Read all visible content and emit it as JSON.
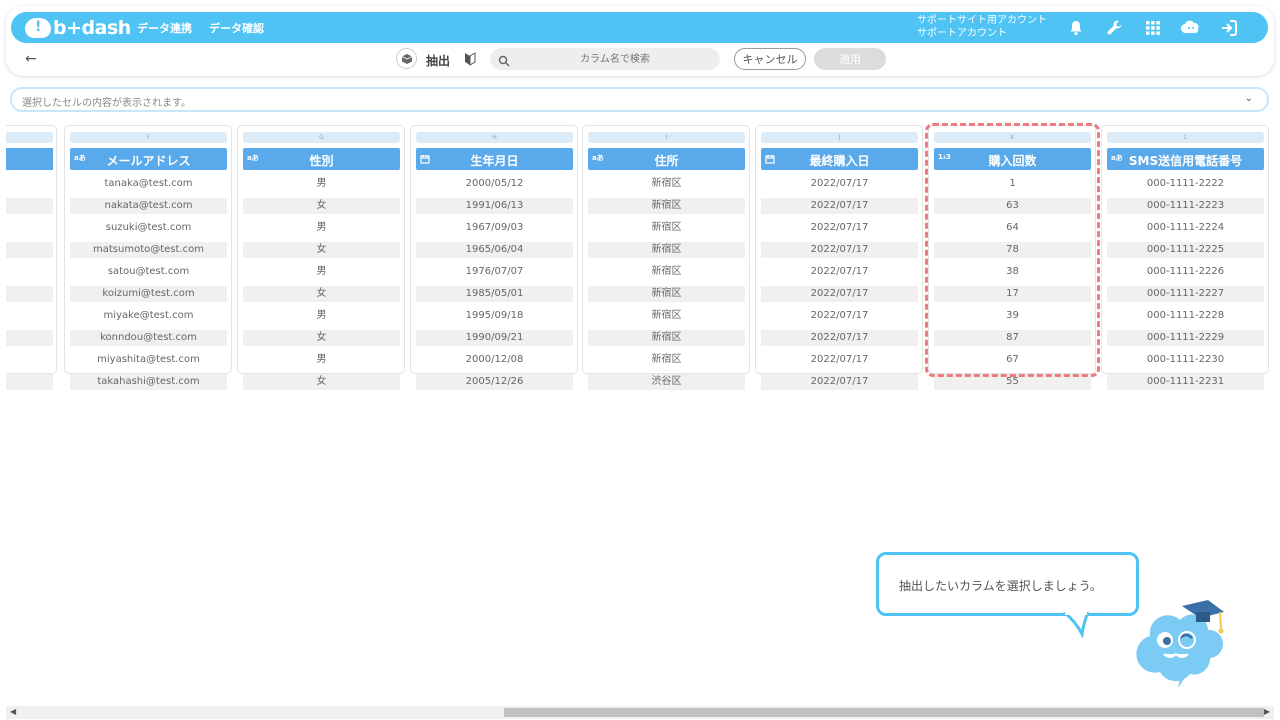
{
  "app": {
    "logo_text": "b+dash"
  },
  "nav": {
    "data_link": "データ連携",
    "data_check": "データ確認"
  },
  "account": {
    "line1": "サポートサイト用アカウント",
    "line2": "サポートアカウント"
  },
  "toolbar": {
    "extract_label": "抽出",
    "search_placeholder": "カラム名で検索",
    "cancel_label": "キャンセル",
    "apply_label": "適用"
  },
  "cell_content": {
    "placeholder": "選択したセルの内容が表示されます。"
  },
  "columns": [
    {
      "letter": "F",
      "type": "aあ",
      "name": "メールアドレス",
      "cells": [
        "tanaka@test.com",
        "nakata@test.com",
        "suzuki@test.com",
        "matsumoto@test.com",
        "satou@test.com",
        "koizumi@test.com",
        "miyake@test.com",
        "konndou@test.com",
        "miyashita@test.com",
        "takahashi@test.com"
      ]
    },
    {
      "letter": "G",
      "type": "aあ",
      "name": "性別",
      "cells": [
        "男",
        "女",
        "男",
        "女",
        "男",
        "女",
        "男",
        "女",
        "男",
        "女"
      ]
    },
    {
      "letter": "H",
      "type": "cal",
      "name": "生年月日",
      "cells": [
        "2000/05/12",
        "1991/06/13",
        "1967/09/03",
        "1965/06/04",
        "1976/07/07",
        "1985/05/01",
        "1995/09/18",
        "1990/09/21",
        "2000/12/08",
        "2005/12/26"
      ]
    },
    {
      "letter": "I",
      "type": "aあ",
      "name": "住所",
      "cells": [
        "新宿区",
        "新宿区",
        "新宿区",
        "新宿区",
        "新宿区",
        "新宿区",
        "新宿区",
        "新宿区",
        "新宿区",
        "渋谷区"
      ]
    },
    {
      "letter": "J",
      "type": "cal",
      "name": "最終購入日",
      "cells": [
        "2022/07/17",
        "2022/07/17",
        "2022/07/17",
        "2022/07/17",
        "2022/07/17",
        "2022/07/17",
        "2022/07/17",
        "2022/07/17",
        "2022/07/17",
        "2022/07/17"
      ]
    },
    {
      "letter": "K",
      "type": "1₂3",
      "name": "購入回数",
      "cells": [
        "1",
        "63",
        "64",
        "78",
        "38",
        "17",
        "39",
        "87",
        "67",
        "55"
      ]
    },
    {
      "letter": "L",
      "type": "aあ",
      "name": "SMS送信用電話番号",
      "cells": [
        "000-1111-2222",
        "000-1111-2223",
        "000-1111-2224",
        "000-1111-2225",
        "000-1111-2226",
        "000-1111-2227",
        "000-1111-2228",
        "000-1111-2229",
        "000-1111-2230",
        "000-1111-2231"
      ]
    }
  ],
  "tip": {
    "text": "抽出したいカラムを選択しましょう。"
  }
}
